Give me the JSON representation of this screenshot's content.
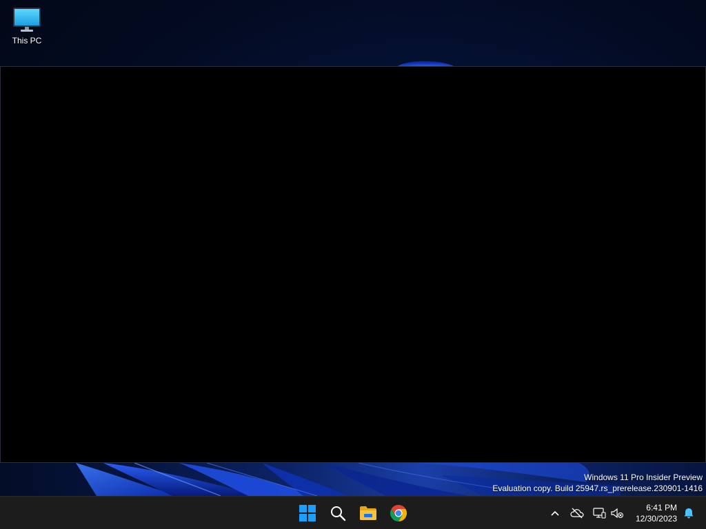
{
  "desktop": {
    "icons": [
      {
        "label": "This PC",
        "icon": "monitor-icon"
      }
    ]
  },
  "watermark": {
    "line1": "Windows 11 Pro Insider Preview",
    "line2": "Evaluation copy. Build 25947.rs_prerelease.230901-1416"
  },
  "taskbar": {
    "pinned": [
      {
        "name": "start",
        "icon": "windows-logo-icon"
      },
      {
        "name": "search",
        "icon": "search-icon"
      },
      {
        "name": "file-explorer",
        "icon": "folder-icon"
      },
      {
        "name": "chrome",
        "icon": "chrome-icon"
      }
    ],
    "tray": [
      {
        "name": "show-hidden-icons",
        "icon": "chevron-up-icon"
      },
      {
        "name": "onedrive",
        "icon": "cloud-offline-icon"
      },
      {
        "name": "network",
        "icon": "network-icon"
      },
      {
        "name": "volume",
        "icon": "speaker-muted-icon"
      }
    ],
    "clock": {
      "time": "6:41 PM",
      "date": "12/30/2023"
    },
    "notifications_icon": "bell-icon"
  },
  "colors": {
    "taskbar_bg": "#1c1c1c",
    "window_bg": "#000000",
    "windows_accent": "#1a9fff",
    "folder_yellow": "#f6c33f",
    "chrome_red": "#db4437",
    "chrome_yellow": "#f4b400",
    "chrome_green": "#0f9d58",
    "chrome_blue": "#4285f4"
  }
}
